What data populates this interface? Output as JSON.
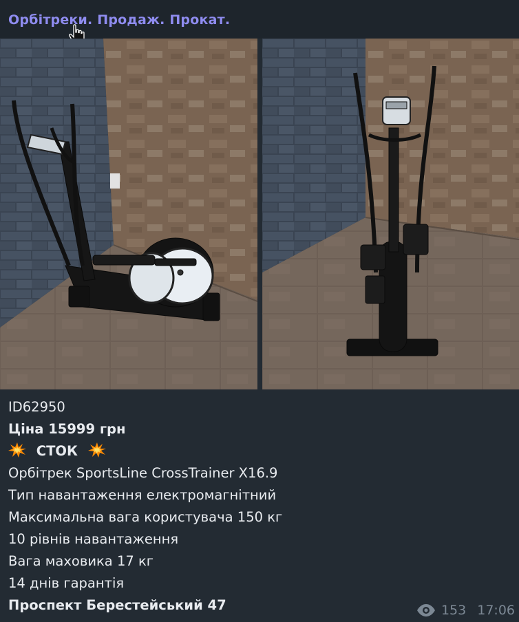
{
  "channel": {
    "title": "Орбітреки. Продаж. Прокат."
  },
  "post": {
    "id_line": "ID62950",
    "price": "Ціна 15999 грн",
    "stock_label": "СТОК",
    "lines": [
      "Орбітрек SportsLine CrossTrainer X16.9",
      "Тип навантаження електромагнітний",
      "Максимальна вага користувача 150 кг",
      "10 рівнів навантаження",
      "Вага маховика 17 кг",
      "14 днів гарантія"
    ],
    "address": "Проспект Берестейський 47"
  },
  "meta": {
    "views": "153",
    "time": "17:06",
    "views_icon": "eye-icon"
  },
  "media": {
    "photos": [
      "elliptical-side-view",
      "elliptical-front-view"
    ]
  },
  "colors": {
    "background": "#232b33",
    "channel_title": "#8f8cf0",
    "text": "#e8ebef",
    "meta": "#7c8894"
  }
}
